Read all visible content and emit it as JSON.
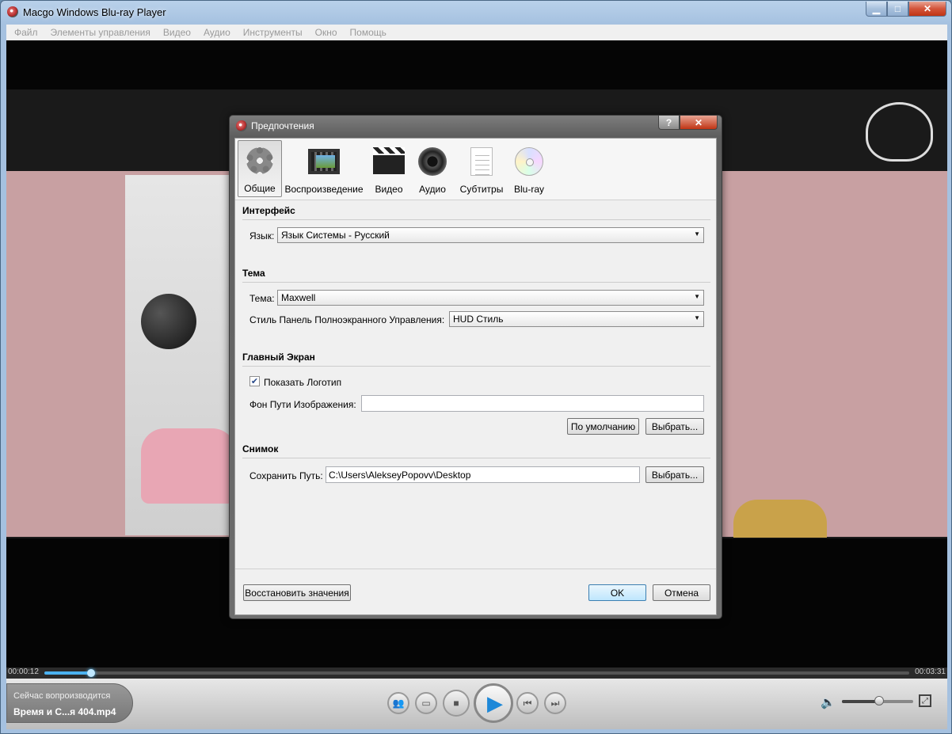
{
  "window": {
    "title": "Macgo Windows Blu-ray Player"
  },
  "menu": [
    "Файл",
    "Элементы управления",
    "Видео",
    "Аудио",
    "Инструменты",
    "Окно",
    "Помощь"
  ],
  "player": {
    "time_elapsed": "00:00:12",
    "time_total": "00:03:31",
    "progress": 0.054,
    "volume": 0.52,
    "now_playing_label": "Сейчас вопроизводится",
    "now_playing_file": "Время и С...я 404.mp4"
  },
  "dialog": {
    "title": "Предпочтения",
    "help_label": "?",
    "tabs": [
      {
        "label": "Общие",
        "icon": "gear-icon"
      },
      {
        "label": "Воспроизведение",
        "icon": "film-strip-icon"
      },
      {
        "label": "Видео",
        "icon": "clapperboard-icon"
      },
      {
        "label": "Аудио",
        "icon": "speaker-icon"
      },
      {
        "label": "Субтитры",
        "icon": "document-icon"
      },
      {
        "label": "Blu-ray",
        "icon": "disc-icon"
      }
    ],
    "selected_tab": "Общие",
    "interface": {
      "heading": "Интерфейс",
      "language_label": "Язык:",
      "language_value": "Язык Системы - Русский"
    },
    "theme": {
      "heading": "Тема",
      "theme_label": "Тема:",
      "theme_value": "Maxwell",
      "fullscreen_label": "Стиль Панель Полноэкранного Управления:",
      "fullscreen_value": "HUD Стиль"
    },
    "main_screen": {
      "heading": "Главный Экран",
      "show_logo_label": "Показать Логотип",
      "show_logo_checked": true,
      "bg_path_label": "Фон Пути Изображения:",
      "bg_path_value": "",
      "default_button": "По умолчанию",
      "browse_button": "Выбрать..."
    },
    "snapshot": {
      "heading": "Снимок",
      "save_path_label": "Сохранить Путь:",
      "save_path_value": "C:\\Users\\AlekseyPopovv\\Desktop",
      "browse_button": "Выбрать..."
    },
    "restore_button": "Восстановить значения",
    "ok_button": "OK",
    "cancel_button": "Отмена"
  },
  "colors": {
    "accent": "#4bb2f0",
    "play": "#1e88d8",
    "close": "#c03414"
  }
}
